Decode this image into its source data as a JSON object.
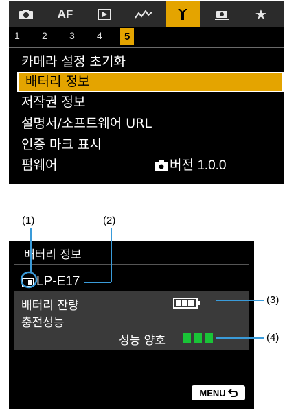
{
  "menu": {
    "tabs": [
      {
        "icon": "camera-icon",
        "label": ""
      },
      {
        "icon": "af-label",
        "label": "AF"
      },
      {
        "icon": "playback-icon",
        "label": ""
      },
      {
        "icon": "wireless-icon",
        "label": ""
      },
      {
        "icon": "wrench-icon",
        "label": ""
      },
      {
        "icon": "custom-functions-icon",
        "label": ""
      },
      {
        "icon": "star-icon",
        "label": "★"
      }
    ],
    "active_tab": 4,
    "pages": [
      "1",
      "2",
      "3",
      "4",
      "5"
    ],
    "active_page": "5",
    "items": [
      {
        "label": "카메라 설정 초기화",
        "value": ""
      },
      {
        "label": "배터리 정보",
        "value": ""
      },
      {
        "label": "저작권 정보",
        "value": ""
      },
      {
        "label": "설명서/소프트웨어 URL",
        "value": ""
      },
      {
        "label": "인증 마크 표시",
        "value": ""
      },
      {
        "label": "펌웨어",
        "value": "버전 1.0.0"
      }
    ],
    "selected_index": 1,
    "accent_color": "#e4a400"
  },
  "battery_info": {
    "callouts": [
      "(1)",
      "(2)",
      "(3)",
      "(4)"
    ],
    "title": "배터리 정보",
    "model": "LP-E17",
    "remaining_label": "배터리 잔량",
    "recharge_label": "충전성능",
    "performance_value": "성능 양호",
    "battery_level_fraction": 0.75,
    "performance_bars": 3,
    "performance_color": "#19c437",
    "menu_button_label": "MENU"
  }
}
